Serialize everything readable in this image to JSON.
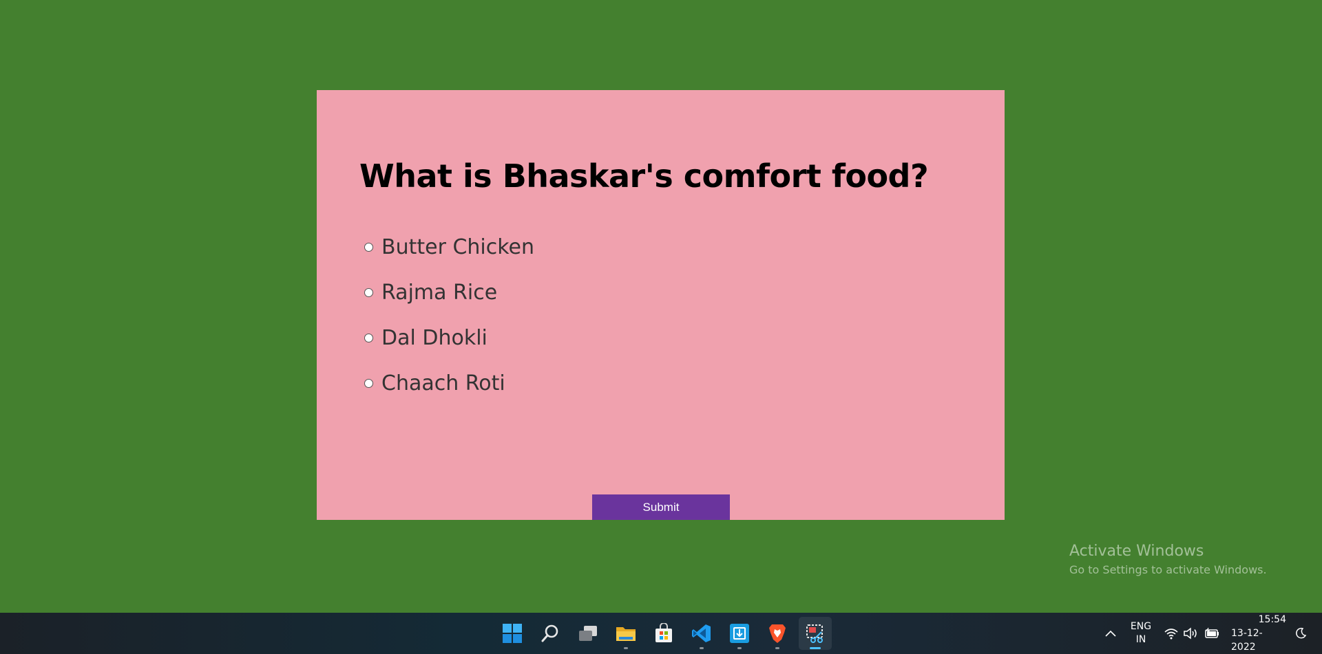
{
  "quiz": {
    "question": "What is Bhaskar's comfort food?",
    "options": [
      {
        "label": "Butter Chicken",
        "selected": false
      },
      {
        "label": "Rajma Rice",
        "selected": false
      },
      {
        "label": "Dal Dhokli",
        "selected": false
      },
      {
        "label": "Chaach Roti",
        "selected": false
      }
    ],
    "submit_label": "Submit"
  },
  "watermark": {
    "title": "Activate Windows",
    "subtitle": "Go to Settings to activate Windows."
  },
  "taskbar": {
    "apps": [
      {
        "icon": "windows-start-icon",
        "running": false,
        "active": false
      },
      {
        "icon": "search-icon",
        "running": false,
        "active": false
      },
      {
        "icon": "task-view-icon",
        "running": false,
        "active": false
      },
      {
        "icon": "file-explorer-icon",
        "running": true,
        "active": false
      },
      {
        "icon": "microsoft-store-icon",
        "running": false,
        "active": false
      },
      {
        "icon": "vscode-icon",
        "running": true,
        "active": false
      },
      {
        "icon": "app-installer-icon",
        "running": true,
        "active": false
      },
      {
        "icon": "brave-browser-icon",
        "running": true,
        "active": false
      },
      {
        "icon": "snipping-tool-icon",
        "running": true,
        "active": true
      }
    ],
    "language": {
      "line1": "ENG",
      "line2": "IN"
    },
    "time": "15:54",
    "date": "13-12-2022"
  },
  "colors": {
    "desktop_background": "#44802f",
    "card_background": "#f0a1ae",
    "submit_background": "#6a349d"
  }
}
